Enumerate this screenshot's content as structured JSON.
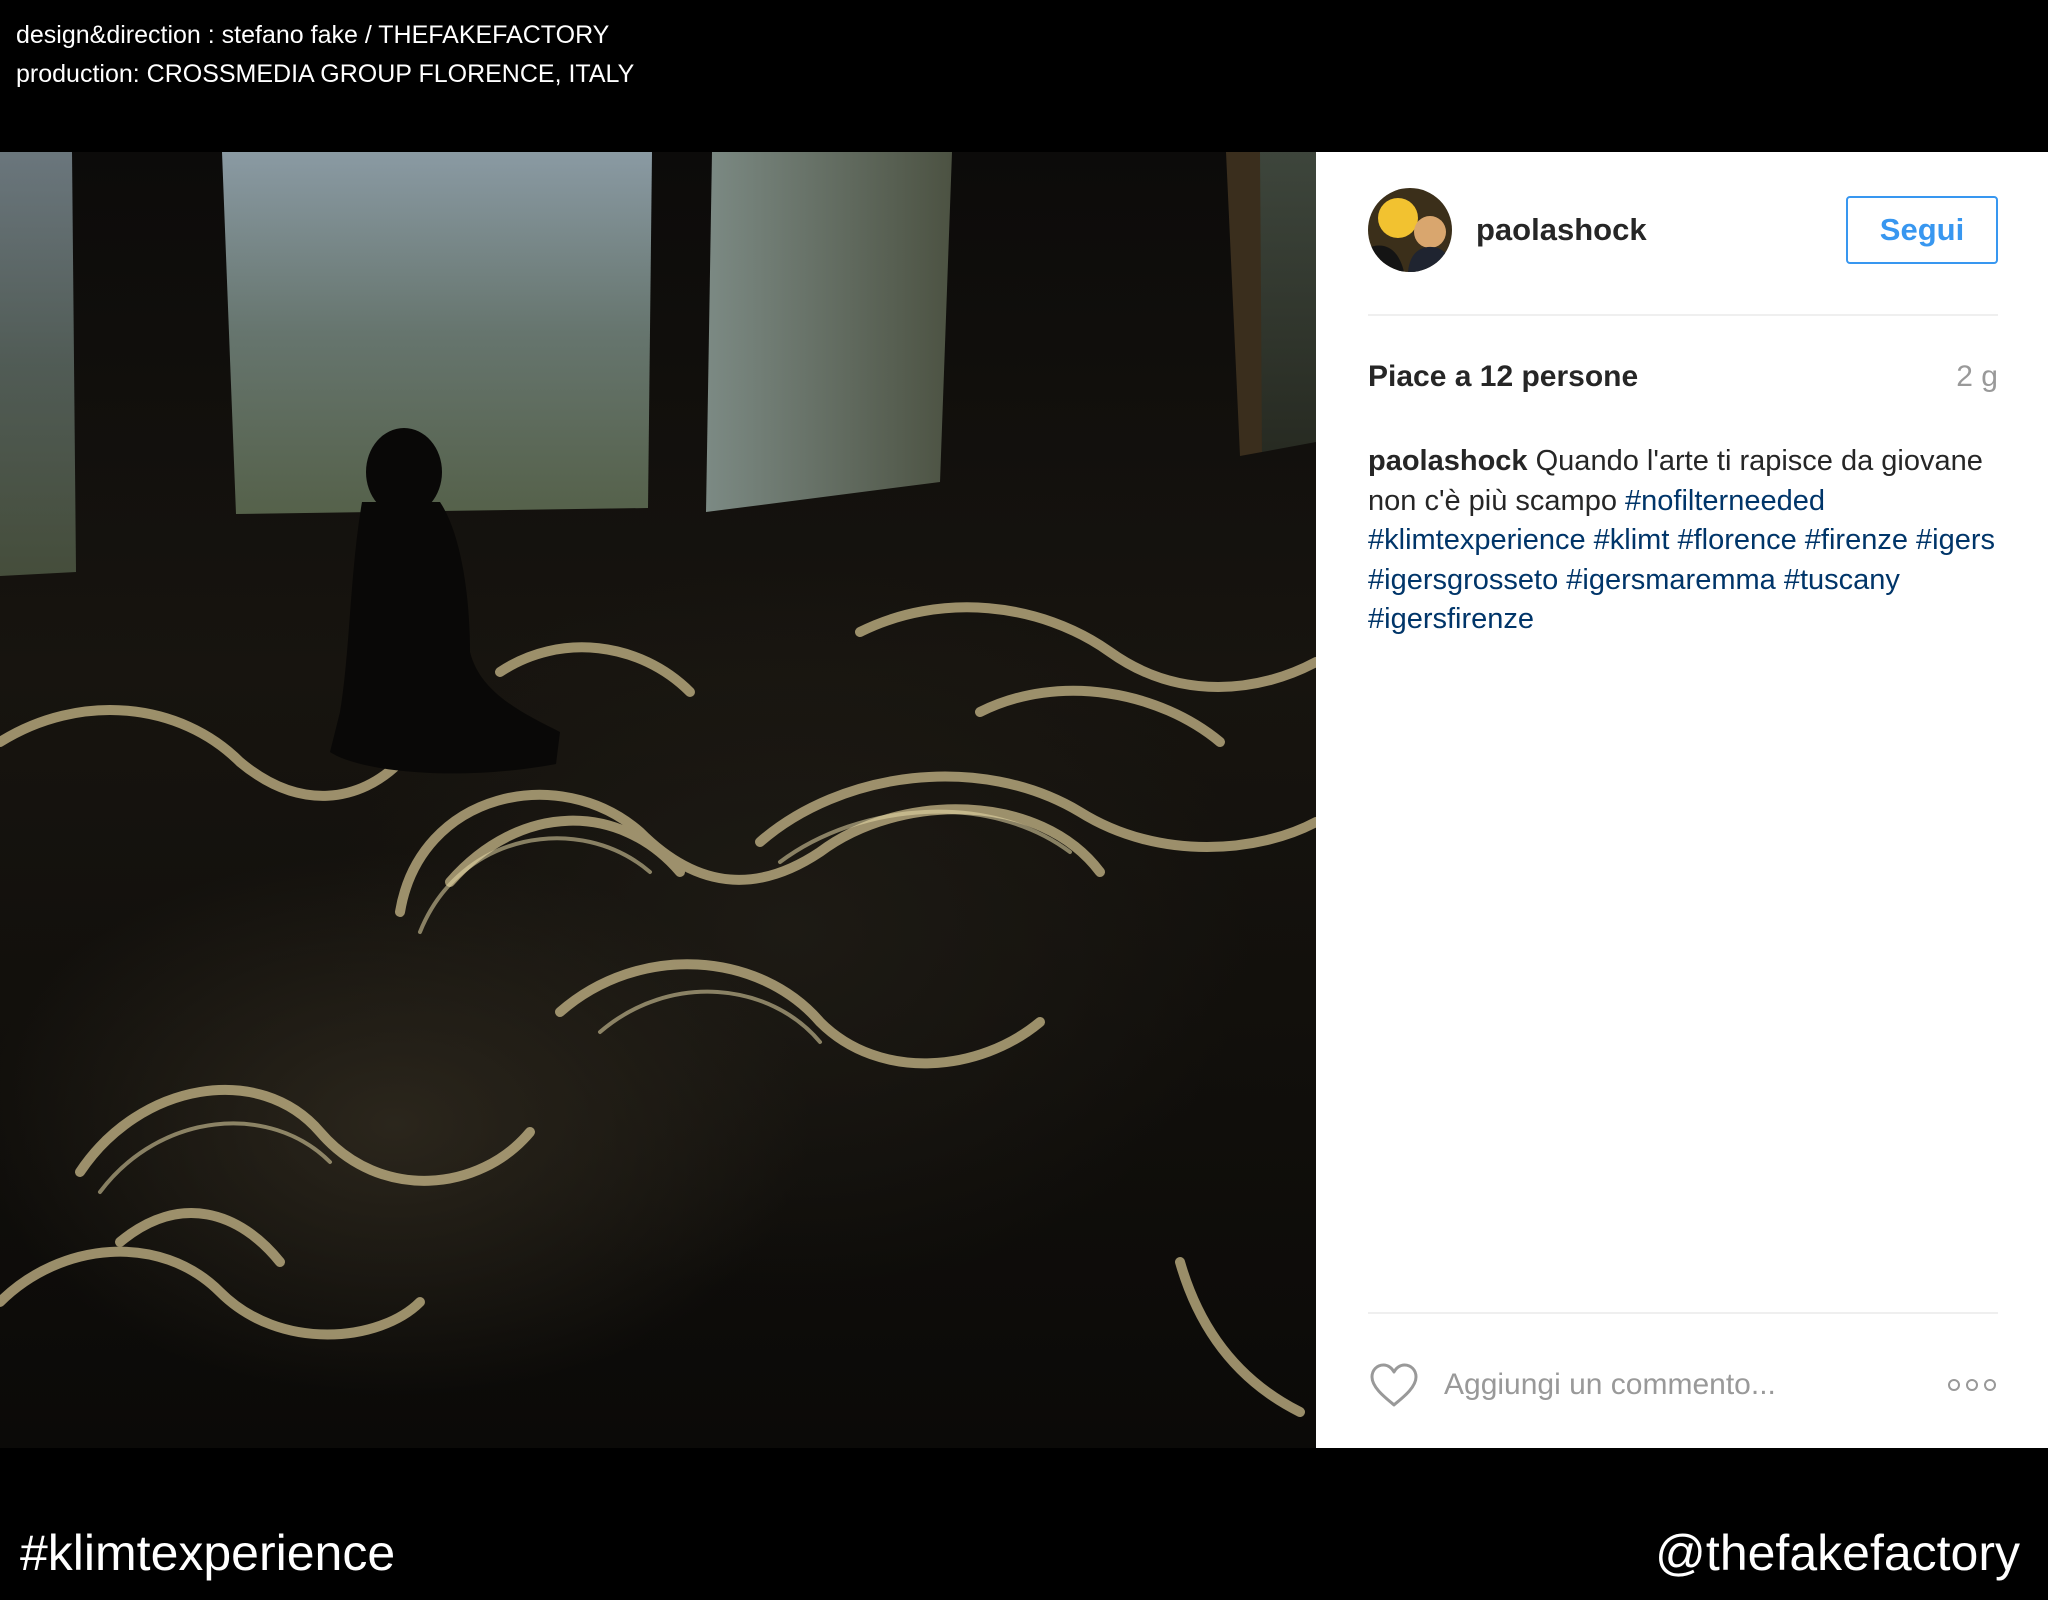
{
  "credits": {
    "line1": "design&direction : stefano fake / THEFAKEFACTORY",
    "line2": "production: CROSSMEDIA GROUP FLORENCE, ITALY"
  },
  "post": {
    "username": "paolashock",
    "follow_label": "Segui",
    "likes_text": "Piace a 12 persone",
    "time_ago": "2 g",
    "caption_owner": "paolashock",
    "caption_text": "Quando l'arte ti rapisce da giovane non c'è più scampo",
    "caption_tags": "#nofilterneeded #klimtexperience #klimt #florence #firenze #igers #igersgrosseto #igersmaremma #tuscany #igersfirenze",
    "comment_placeholder": "Aggiungi un commento..."
  },
  "footer": {
    "hashtag": "#klimtexperience",
    "handle": "@thefakefactory"
  },
  "colors": {
    "accent": "#3897f0",
    "hashtag": "#003569",
    "text": "#262626",
    "muted": "#999999"
  },
  "icons": [
    "heart-icon",
    "more-options-icon"
  ]
}
